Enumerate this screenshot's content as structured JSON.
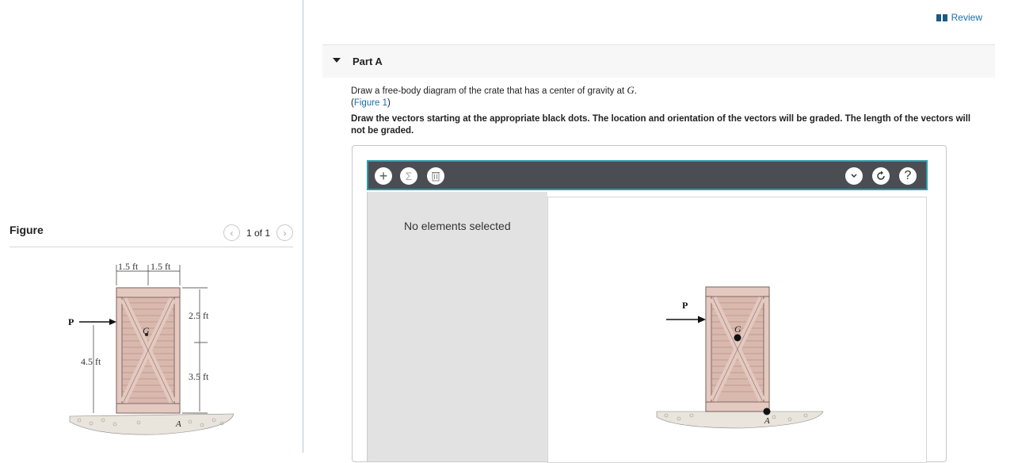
{
  "figure": {
    "title": "Figure",
    "pager_text": "1 of 1",
    "labels": {
      "dim_left_width": "1.5 ft",
      "dim_right_width": "1.5 ft",
      "dim_upper": "2.5 ft",
      "dim_lower": "3.5 ft",
      "dim_force_height": "4.5 ft",
      "force": "P",
      "center": "G",
      "corner": "A"
    }
  },
  "review": {
    "label": "Review"
  },
  "part": {
    "title": "Part A",
    "instruction_text": "Draw a free-body diagram of the crate that has a center of gravity at ",
    "instruction_symbol": "G",
    "instruction_end": ".",
    "figure_link": "Figure 1",
    "bold_instruction": "Draw the vectors starting at the appropriate black dots. The location and orientation of the vectors will be graded. The length of the vectors will not be graded."
  },
  "tool": {
    "add_symbol": "+",
    "sum_symbol": "Σ",
    "help_symbol": "?",
    "no_selection": "No elements selected",
    "canvas_labels": {
      "force": "P",
      "center": "G",
      "corner": "A"
    }
  },
  "colors": {
    "crate_fill": "#d9b8ad",
    "crate_plank": "#b89289",
    "accent": "#1a6fa8",
    "toolbar": "#4a4d52",
    "toolbar_border": "#2a9fa8"
  }
}
